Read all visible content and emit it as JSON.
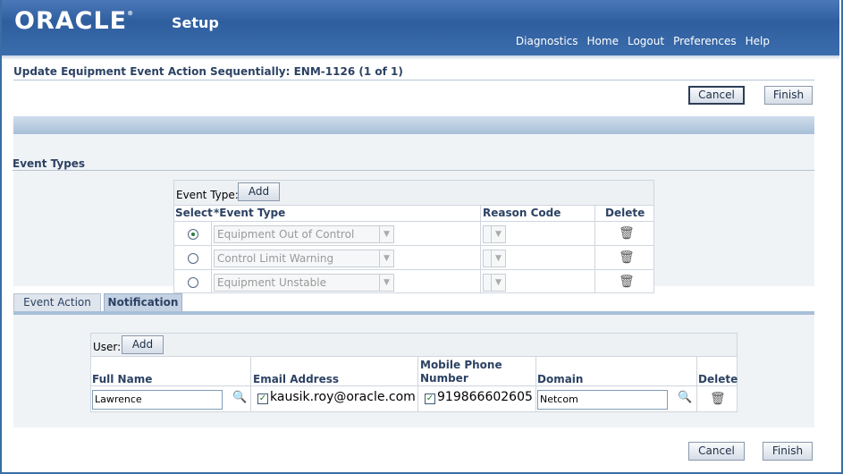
{
  "header": {
    "logo": "ORACLE",
    "app_name": "Setup",
    "links": [
      "Diagnostics",
      "Home",
      "Logout",
      "Preferences",
      "Help"
    ]
  },
  "page": {
    "title": "Update Equipment Event Action Sequentially: ENM-1126 (1 of 1)",
    "cancel_label": "Cancel",
    "finish_label": "Finish"
  },
  "event_types": {
    "section_title": "Event Types",
    "toolbar_label": "Event Type:",
    "add_label": "Add",
    "columns": {
      "select": "Select",
      "event_type": "*Event Type",
      "reason_code": "Reason Code",
      "delete": "Delete"
    },
    "rows": [
      {
        "event_type": "Equipment Out of Control",
        "selected": true
      },
      {
        "event_type": "Control Limit Warning",
        "selected": false
      },
      {
        "event_type": "Equipment Unstable",
        "selected": false
      }
    ]
  },
  "tabs": [
    {
      "label": "Event Action",
      "active": false
    },
    {
      "label": "Notification",
      "active": true
    }
  ],
  "users": {
    "toolbar_label": "User:",
    "add_label": "Add",
    "columns": {
      "full_name": "Full Name",
      "email": "Email Address",
      "mobile": "Mobile Phone Number",
      "domain": "Domain",
      "delete": "Delete"
    },
    "rows": [
      {
        "full_name": "Lawrence",
        "email": "kausik.roy@oracle.com",
        "mobile": "919866602605",
        "domain": "Netcom"
      }
    ]
  },
  "colors": {
    "header": "#2f5e9e",
    "accent": "#a7bfd8",
    "label": "#2c4263"
  },
  "icons": {
    "search": "search-icon",
    "delete": "trash-icon",
    "dropdown": "chevron-down-icon"
  }
}
